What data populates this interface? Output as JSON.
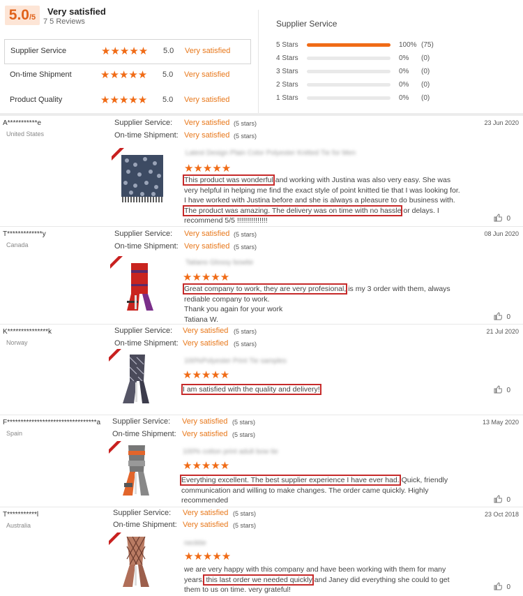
{
  "summary": {
    "score": "5.0",
    "score_suffix": "/5",
    "headline": "Very satisfied",
    "reviews_count": "7 5 Reviews",
    "ratings": [
      {
        "label": "Supplier Service",
        "stars": "★★★★★",
        "score": "5.0",
        "text": "Very satisfied"
      },
      {
        "label": "On-time Shipment",
        "stars": "★★★★★",
        "score": "5.0",
        "text": "Very satisfied"
      },
      {
        "label": "Product Quality",
        "stars": "★★★★★",
        "score": "5.0",
        "text": "Very satisfied"
      }
    ],
    "distribution_title": "Supplier Service",
    "distribution": [
      {
        "label": "5 Stars",
        "percent": "100%",
        "count": "(75)",
        "fraction": 1.0
      },
      {
        "label": "4 Stars",
        "percent": "0%",
        "count": "(0)",
        "fraction": 0
      },
      {
        "label": "3 Stars",
        "percent": "0%",
        "count": "(0)",
        "fraction": 0
      },
      {
        "label": "2 Stars",
        "percent": "0%",
        "count": "(0)",
        "fraction": 0
      },
      {
        "label": "1 Stars",
        "percent": "0%",
        "count": "(0)",
        "fraction": 0
      }
    ]
  },
  "labels": {
    "supplier_service": "Supplier Service:",
    "ontime_shipment": "On-time Shipment:",
    "very_satisfied": "Very satisfied",
    "five_stars_note": "(5 stars)",
    "stars": "★★★★★"
  },
  "reviews": [
    {
      "user": "A***********e",
      "country": "United States",
      "date": "23 Jun 2020",
      "product": "Latest Design Plain Color Polyester Knitted Tie for Men",
      "body_pre": "",
      "hl1": "This product was wonderful",
      "mid": " and working with Justina was also very easy. She was very helpful in helping me find the exact style of point knitted tie that I was looking for. I have worked with Justina before and she is always a pleasure to do business with. ",
      "hl2": "The product was amazing. The delivery was on time with no hassle",
      "post": " or delays. I recommend 5/5 !!!!!!!!!!!!!!!",
      "likes": "0"
    },
    {
      "user": "T*************y",
      "country": "Canada",
      "date": "08 Jun 2020",
      "product": "Tatiano Glossy bowtie",
      "body_pre": "",
      "hl1": "Great company to work, they are very profesional,",
      "mid": " is my 3 order with them, always rediable company to work.",
      "extra_lines": [
        "Thank you again for your work",
        "Tatiana W."
      ],
      "likes": "0"
    },
    {
      "user": "K***************k",
      "country": "Norway",
      "date": "21 Jul 2020",
      "product": "100%Polyester Print Tie samples",
      "hl1": "I am satisfied with the quality and delivery!",
      "likes": "0"
    },
    {
      "user": "F*********************************a",
      "country": "Spain",
      "date": "13 May 2020",
      "product": "100% cotton print adult bow tie",
      "hl1": "Everything excellent. The best supplier experience I have ever had.",
      "mid": " Quick, friendly communication and willing to make changes. The order came quickly. Highly recommended",
      "likes": "0"
    },
    {
      "user": "T***********l",
      "country": "Australia",
      "date": "23 Oct 2018",
      "product": "necktie",
      "body_pre": "we are very happy with this company and have been working with them for many years.",
      "hl1": " this last order we needed quickly",
      "mid": " and Janey did everything she could to get them to us on time.  very grateful!",
      "likes": "0"
    }
  ],
  "colors": {
    "accent": "#f06b16",
    "satisfied": "#e8781b",
    "highlight_border": "#c62a2a"
  },
  "icons": {
    "like": "thumb-up-icon"
  }
}
